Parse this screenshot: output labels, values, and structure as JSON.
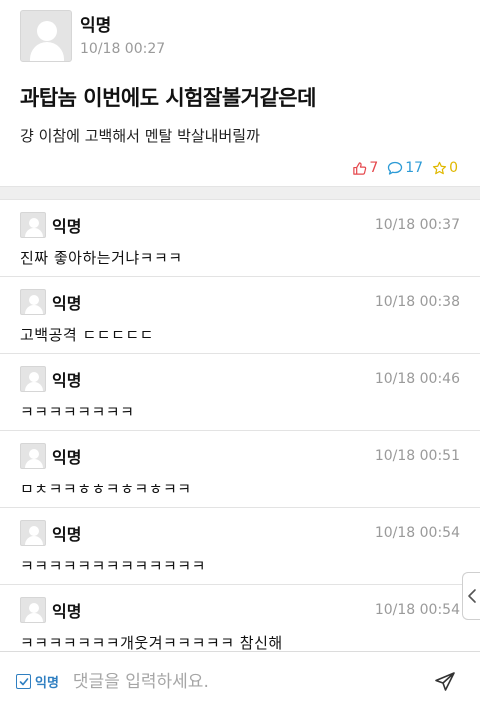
{
  "post": {
    "author": "익명",
    "time": "10/18 00:27",
    "title": "과탑놈 이번에도 시험잘볼거같은데",
    "body": "걍 이참에 고백해서 멘탈 박살내버릴까",
    "likes": "7",
    "comments": "17",
    "scraps": "0"
  },
  "comments": [
    {
      "author": "익명",
      "time": "10/18 00:37",
      "text": "진짜 좋아하는거냐ㅋㅋㅋ"
    },
    {
      "author": "익명",
      "time": "10/18 00:38",
      "text": "고백공격 ㄷㄷㄷㄷㄷ"
    },
    {
      "author": "익명",
      "time": "10/18 00:46",
      "text": "ㅋㅋㅋㅋㅋㅋㅋㅋ"
    },
    {
      "author": "익명",
      "time": "10/18 00:51",
      "text": "ㅁㅊㅋㅋㅎㅎㅋㅎㅋㅎㅋㅋ"
    },
    {
      "author": "익명",
      "time": "10/18 00:54",
      "text": "ㅋㅋㅋㅋㅋㅋㅋㅋㅋㅋㅋㅋㅋ"
    },
    {
      "author": "익명",
      "time": "10/18 00:54",
      "text": "ㅋㅋㅋㅋㅋㅋㅋ개웃겨ㅋㅋㅋㅋㅋ 참신해"
    }
  ],
  "composer": {
    "anon_label": "익명",
    "placeholder": "댓글을 입력하세요."
  },
  "icons": {
    "like": "thumbs-up-icon",
    "comment": "speech-bubble-icon",
    "scrap": "star-icon",
    "send": "send-icon",
    "side": "chevron-left-icon"
  },
  "colors": {
    "like": "#e5484d",
    "comment": "#2d9bd6",
    "scrap": "#e0b800",
    "anon": "#2f7fc1"
  }
}
